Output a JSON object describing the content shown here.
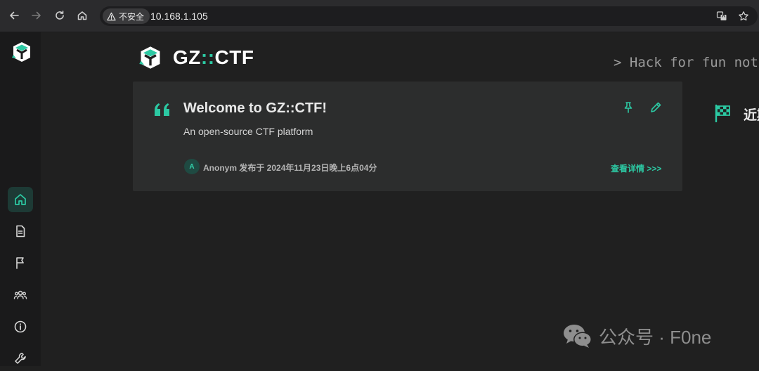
{
  "browser": {
    "security_label": "不安全",
    "url": "10.168.1.105",
    "icons": [
      "back-icon",
      "forward-icon",
      "reload-icon",
      "home-icon",
      "warning-icon",
      "translate-icon",
      "star-icon"
    ]
  },
  "sidebar": {
    "items": [
      {
        "name": "home",
        "icon": "home-icon",
        "active": true
      },
      {
        "name": "posts",
        "icon": "document-icon",
        "active": false
      },
      {
        "name": "games",
        "icon": "flag-icon",
        "active": false
      },
      {
        "name": "teams",
        "icon": "users-icon",
        "active": false
      },
      {
        "name": "about",
        "icon": "info-icon",
        "active": false
      },
      {
        "name": "admin",
        "icon": "wrench-icon",
        "active": false
      }
    ]
  },
  "brand": {
    "name_left": "GZ",
    "name_sep": "::",
    "name_right": "CTF",
    "slogan": "> Hack for fun not"
  },
  "post": {
    "title": "Welcome to GZ::CTF!",
    "summary": "An open-source CTF platform",
    "avatar_letter": "A",
    "author": "Anonym",
    "meta": "发布于 2024年11月23日晚上6点04分",
    "details_link": "查看详情 >>>"
  },
  "recent": {
    "label": "近期"
  },
  "watermark": {
    "text": "公众号 · F0ne"
  },
  "colors": {
    "accent": "#2cc9a3",
    "background": "#202020",
    "card": "#2c2d2d",
    "sidebar": "#1a1a1b"
  }
}
